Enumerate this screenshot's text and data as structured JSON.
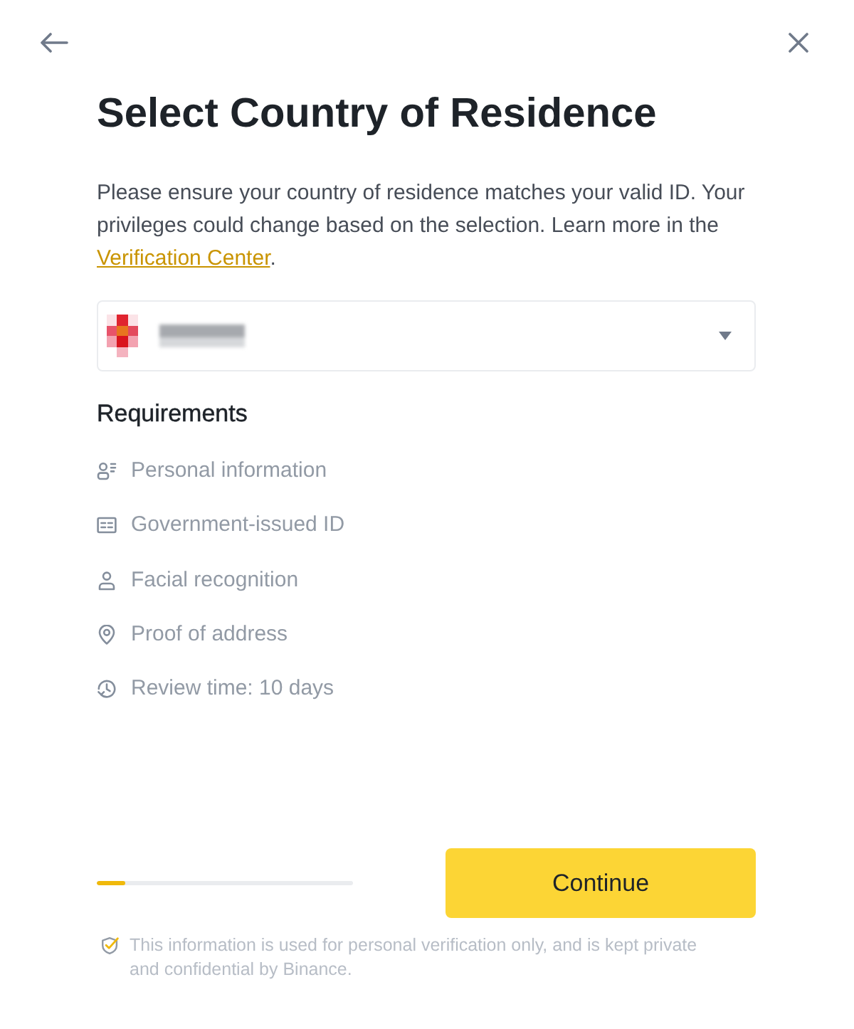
{
  "title": "Select Country of Residence",
  "intro": {
    "text": "Please ensure your country of residence matches your valid ID. Your privileges could change based on the selection. Learn more in the ",
    "link": "Verification Center",
    "end": "."
  },
  "requirements": {
    "heading": "Requirements",
    "items": [
      {
        "kind": "personal_info",
        "label": "Personal information"
      },
      {
        "kind": "id_document",
        "label": "Government-issued ID"
      },
      {
        "kind": "face",
        "label": "Facial recognition"
      },
      {
        "kind": "address",
        "label": "Proof of address"
      },
      {
        "kind": "review_time",
        "label": "Review time: 10 days"
      }
    ]
  },
  "progress": {
    "level": 0.11
  },
  "continue_button": "Continue",
  "notice": "This information is used for personal verification only, and is kept private and confidential by Binance."
}
